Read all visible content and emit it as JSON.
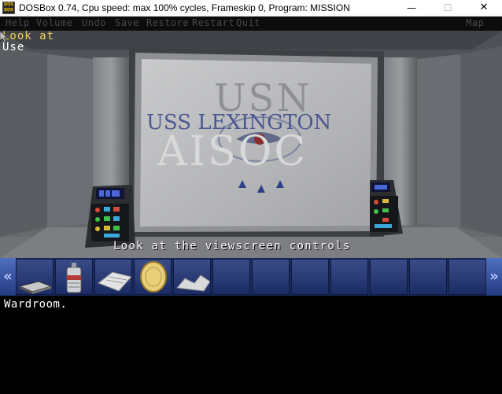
{
  "window": {
    "title": "DOSBox 0.74, Cpu speed: max 100% cycles, Frameskip  0, Program:  MISSION",
    "icon_text": "DOS BOX",
    "minimize_icon": "minimize-icon",
    "maximize_icon": "maximize-icon",
    "close_icon": "close-icon"
  },
  "menu": {
    "items": [
      "Help",
      "Volume",
      "Undo",
      "Save",
      "Restore",
      "Restart",
      "Quit"
    ],
    "map": "Map"
  },
  "verbs": {
    "look_at": "Look at",
    "use": "Use"
  },
  "scene": {
    "screen_line1": "USN",
    "screen_line2": "USS LEXINGTON",
    "screen_line3": "AISOC"
  },
  "caption": "Look at the viewscreen controls",
  "inventory": {
    "left_arrow": "«",
    "right_arrow": "»",
    "items": [
      "laptop-icon",
      "robot-canister-icon",
      "folded-paper-icon",
      "gold-coin-icon",
      "crumpled-note-icon"
    ],
    "empty_slots": 7
  },
  "room_text": "Wardroom.",
  "colors": {
    "verb_highlight": "#f0d060",
    "inventory_bg": "#1a2a5c",
    "menu_text": "#4a4a4a"
  }
}
